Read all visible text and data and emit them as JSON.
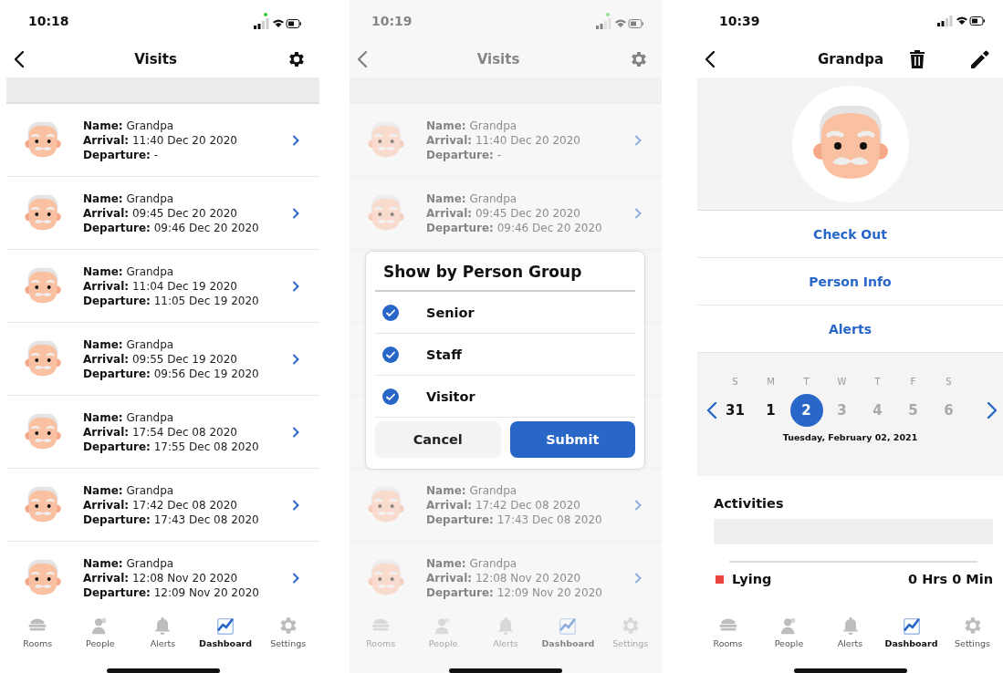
{
  "screens": [
    {
      "kind": "visits",
      "dimmed": false,
      "camera_indicator": true,
      "status_time": "10:18",
      "nav": {
        "title": "Visits"
      },
      "visits": [
        {
          "kind": "visit",
          "name_label": "Name:",
          "name": "Grandpa",
          "arrival_label": "Arrival:",
          "arrival": "11:40 Dec 20 2020",
          "departure_label": "Departure:",
          "departure": "-"
        },
        {
          "kind": "visit",
          "name_label": "Name:",
          "name": "Grandpa",
          "arrival_label": "Arrival:",
          "arrival": "09:45 Dec 20 2020",
          "departure_label": "Departure:",
          "departure": "09:46 Dec 20 2020"
        },
        {
          "kind": "visit",
          "name_label": "Name:",
          "name": "Grandpa",
          "arrival_label": "Arrival:",
          "arrival": "11:04 Dec 19 2020",
          "departure_label": "Departure:",
          "departure": "11:05 Dec 19 2020"
        },
        {
          "kind": "visit",
          "name_label": "Name:",
          "name": "Grandpa",
          "arrival_label": "Arrival:",
          "arrival": "09:55 Dec 19 2020",
          "departure_label": "Departure:",
          "departure": "09:56 Dec 19 2020"
        },
        {
          "kind": "visit",
          "name_label": "Name:",
          "name": "Grandpa",
          "arrival_label": "Arrival:",
          "arrival": "17:54 Dec 08 2020",
          "departure_label": "Departure:",
          "departure": "17:55 Dec 08 2020"
        },
        {
          "kind": "visit",
          "name_label": "Name:",
          "name": "Grandpa",
          "arrival_label": "Arrival:",
          "arrival": "17:42 Dec 08 2020",
          "departure_label": "Departure:",
          "departure": "17:43 Dec 08 2020"
        },
        {
          "kind": "visit",
          "name_label": "Name:",
          "name": "Grandpa",
          "arrival_label": "Arrival:",
          "arrival": "12:08 Nov 20 2020",
          "departure_label": "Departure:",
          "departure": "12:09 Nov 20 2020"
        }
      ],
      "tab_bar": [
        {
          "label": "Rooms",
          "selected": false
        },
        {
          "label": "People",
          "selected": false
        },
        {
          "label": "Alerts",
          "selected": false
        },
        {
          "label": "Dashboard",
          "selected": true
        },
        {
          "label": "Settings",
          "selected": false
        }
      ]
    },
    {
      "kind": "visits",
      "dimmed": true,
      "camera_indicator": true,
      "status_time": "10:19",
      "nav": {
        "title": "Visits"
      },
      "visits": [
        {
          "kind": "visit",
          "name_label": "Name:",
          "name": "Grandpa",
          "arrival_label": "Arrival:",
          "arrival": "11:40 Dec 20 2020",
          "departure_label": "Departure:",
          "departure": "-"
        },
        {
          "kind": "visit",
          "name_label": "Name:",
          "name": "Grandpa",
          "arrival_label": "Arrival:",
          "arrival": "09:45 Dec 20 2020",
          "departure_label": "Departure:",
          "departure": "09:46 Dec 20 2020"
        },
        {
          "kind": "covered"
        },
        {
          "kind": "covered"
        },
        {
          "kind": "covered"
        },
        {
          "kind": "visit",
          "name_label": "Name:",
          "name": "Grandpa",
          "arrival_label": "Arrival:",
          "arrival": "17:42 Dec 08 2020",
          "departure_label": "Departure:",
          "departure": "17:43 Dec 08 2020"
        },
        {
          "kind": "visit",
          "name_label": "Name:",
          "name": "Grandpa",
          "arrival_label": "Arrival:",
          "arrival": "12:08 Nov 20 2020",
          "departure_label": "Departure:",
          "departure": "12:09 Nov 20 2020"
        }
      ],
      "dialog": {
        "title": "Show by Person Group",
        "options": [
          {
            "label": "Senior",
            "checked": true
          },
          {
            "label": "Staff",
            "checked": true
          },
          {
            "label": "Visitor",
            "checked": true
          }
        ],
        "cancel": "Cancel",
        "submit": "Submit"
      },
      "tab_bar": [
        {
          "label": "Rooms",
          "selected": false
        },
        {
          "label": "People",
          "selected": false
        },
        {
          "label": "Alerts",
          "selected": false
        },
        {
          "label": "Dashboard",
          "selected": true
        },
        {
          "label": "Settings",
          "selected": false
        }
      ]
    },
    {
      "kind": "person",
      "dimmed": false,
      "camera_indicator": false,
      "status_time": "10:39",
      "nav": {
        "title": "Grandpa"
      },
      "actions": [
        "Check Out",
        "Person Info",
        "Alerts"
      ],
      "calendar": {
        "weekdays": [
          "S",
          "M",
          "T",
          "W",
          "T",
          "F",
          "S"
        ],
        "days": [
          {
            "label": "31",
            "selected": false,
            "disabled": false
          },
          {
            "label": "1",
            "selected": false,
            "disabled": false
          },
          {
            "label": "2",
            "selected": true,
            "disabled": false
          },
          {
            "label": "3",
            "selected": false,
            "disabled": true
          },
          {
            "label": "4",
            "selected": false,
            "disabled": true
          },
          {
            "label": "5",
            "selected": false,
            "disabled": true
          },
          {
            "label": "6",
            "selected": false,
            "disabled": true
          }
        ],
        "date": "Tuesday, February 02, 2021"
      },
      "activities": {
        "title": "Activities",
        "items": [
          {
            "label": "Lying",
            "value": "0 Hrs 0 Min",
            "color": "#e8453c"
          }
        ]
      },
      "tab_bar": [
        {
          "label": "Rooms",
          "selected": false
        },
        {
          "label": "People",
          "selected": false
        },
        {
          "label": "Alerts",
          "selected": false
        },
        {
          "label": "Dashboard",
          "selected": true
        },
        {
          "label": "Settings",
          "selected": false
        }
      ]
    }
  ]
}
